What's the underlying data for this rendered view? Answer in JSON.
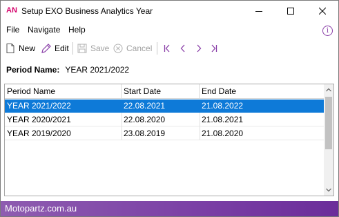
{
  "window": {
    "app_badge": "AN",
    "title": "Setup EXO Business Analytics Year"
  },
  "menu": {
    "items": [
      "File",
      "Navigate",
      "Help"
    ],
    "info_symbol": "i"
  },
  "toolbar": {
    "new_label": "New",
    "edit_label": "Edit",
    "save_label": "Save",
    "cancel_label": "Cancel"
  },
  "period": {
    "label": "Period Name:",
    "value": "YEAR 2021/2022"
  },
  "grid": {
    "columns": [
      "Period Name",
      "Start Date",
      "End Date"
    ],
    "rows": [
      [
        "YEAR 2021/2022",
        "22.08.2021",
        "21.08.2022"
      ],
      [
        "YEAR 2020/2021",
        "22.08.2020",
        "21.08.2021"
      ],
      [
        "YEAR 2019/2020",
        "23.08.2019",
        "21.08.2020"
      ]
    ],
    "selected_row": 0
  },
  "footer": {
    "text": "Motopartz.com.au"
  },
  "colors": {
    "accent": "#d4006a",
    "selection": "#0e7ad8",
    "footer": "#7a3fa5"
  }
}
